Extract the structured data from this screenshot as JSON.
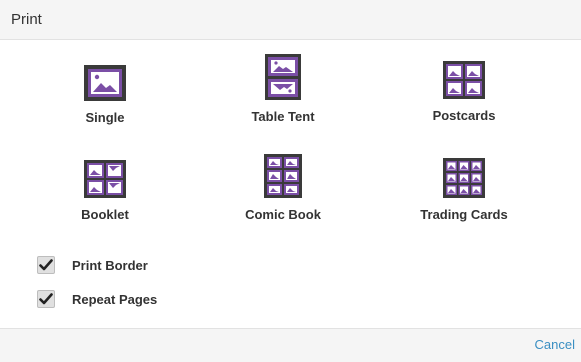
{
  "dialog": {
    "title": "Print",
    "colors": {
      "accent": "#7b4fa6",
      "frame": "#3a3a3a",
      "link": "#3a8fc2"
    }
  },
  "layouts": [
    {
      "label": "Single",
      "icon": "single-layout-icon"
    },
    {
      "label": "Table Tent",
      "icon": "table-tent-layout-icon"
    },
    {
      "label": "Postcards",
      "icon": "postcards-layout-icon"
    },
    {
      "label": "Booklet",
      "icon": "booklet-layout-icon"
    },
    {
      "label": "Comic Book",
      "icon": "comic-book-layout-icon"
    },
    {
      "label": "Trading Cards",
      "icon": "trading-cards-layout-icon"
    }
  ],
  "options": {
    "print_border": {
      "label": "Print Border",
      "checked": true
    },
    "repeat_pages": {
      "label": "Repeat Pages",
      "checked": true
    }
  },
  "footer": {
    "cancel_label": "Cancel"
  }
}
